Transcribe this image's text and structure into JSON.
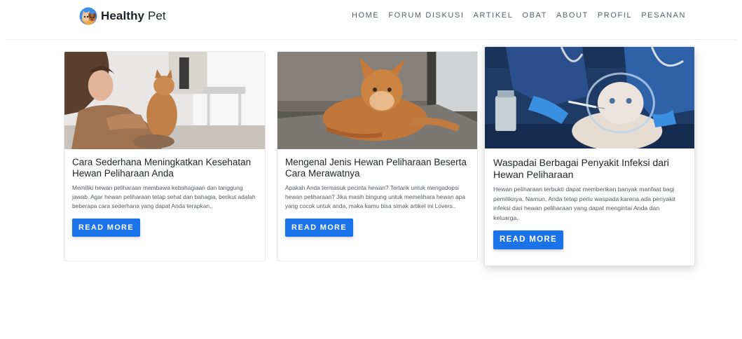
{
  "brand": {
    "name_bold": "Healthy",
    "name_light": "Pet",
    "logo_icon": "pet-logo-icon"
  },
  "nav": {
    "items": [
      {
        "label": "HOME"
      },
      {
        "label": "FORUM DISKUSI"
      },
      {
        "label": "ARTIKEL"
      },
      {
        "label": "OBAT"
      },
      {
        "label": "ABOUT"
      },
      {
        "label": "PROFIL"
      },
      {
        "label": "PESANAN"
      }
    ]
  },
  "colors": {
    "accent": "#1a73e8",
    "text": "#212529",
    "nav_text": "#5a6068"
  },
  "articles": [
    {
      "image": "woman-with-cat-photo",
      "title": "Cara Sederhana Meningkatkan Kesehatan Hewan Peliharaan Anda",
      "excerpt": "Memiliki hewan peliharaan membawa kebahagiaan dan tanggung jawab. Agar hewan peliharaan tetap sehat dan bahagia, berikut adalah beberapa cara sederhana yang dapat Anda terapkan..",
      "button": "READ MORE"
    },
    {
      "image": "orange-cat-photo",
      "title": "Mengenal Jenis Hewan Peliharaan Beserta Cara Merawatnya",
      "excerpt": "Apakah Anda termasuk pecinta hewan? Tertarik untuk mengadopsi hewan peliharaan? Jika masih bingung untuk memelihara hewan apa yang cocok untuk anda, maka kamu bisa simak artikel ini Lovers..",
      "button": "READ MORE"
    },
    {
      "image": "vet-injecting-cat-photo",
      "title": "Waspadai Berbagai Penyakit Infeksi dari Hewan Peliharaan",
      "excerpt": "Hewan peliharaan terbukti dapat memberikan banyak manfaat bagi pemiliknya. Namun, Anda tetap perlu waspada karena ada penyakit infeksi dari hewan peliharaan yang dapat mengintai Anda dan keluarga..",
      "button": "READ MORE"
    }
  ]
}
